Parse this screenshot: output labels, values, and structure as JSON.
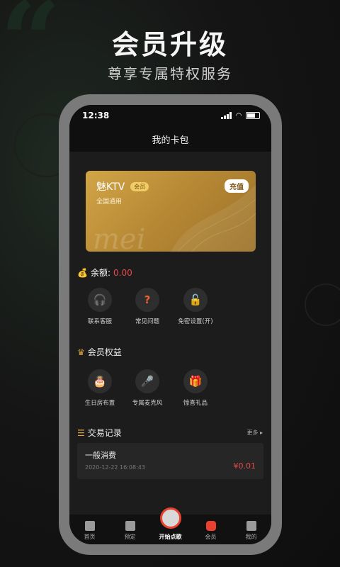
{
  "hero": {
    "title": "会员升级",
    "subtitle": "尊享专属特权服务"
  },
  "status_bar": {
    "time": "12:38"
  },
  "header": {
    "title": "我的卡包"
  },
  "card": {
    "name": "魅KTV",
    "badge": "会员",
    "scope": "全国通用",
    "recharge_label": "充值",
    "watermark": "mei",
    "color": "#c0913a"
  },
  "balance": {
    "label": "余额:",
    "value": "0.00"
  },
  "services": [
    {
      "label": "联系客服",
      "icon": "headset-icon"
    },
    {
      "label": "常见问题",
      "icon": "question-icon"
    },
    {
      "label": "免密设置(开)",
      "icon": "unlock-icon"
    }
  ],
  "benefits": {
    "title": "会员权益",
    "items": [
      {
        "label": "生日房布置",
        "icon": "cake-icon"
      },
      {
        "label": "专属麦克风",
        "icon": "microphone-icon"
      },
      {
        "label": "惊喜礼品",
        "icon": "gift-icon"
      }
    ]
  },
  "transactions": {
    "title": "交易记录",
    "more_label": "更多 ▸",
    "items": [
      {
        "title": "一般消费",
        "time": "2020-12-22 16:08:43",
        "amount": "¥0.01"
      }
    ]
  },
  "tabbar": [
    {
      "label": "首页",
      "icon": "home-icon"
    },
    {
      "label": "预定",
      "icon": "clipboard-icon"
    },
    {
      "label": "开始点歌",
      "icon": "microphone-icon"
    },
    {
      "label": "会员",
      "icon": "crown-icon"
    },
    {
      "label": "我的",
      "icon": "user-icon"
    }
  ],
  "colors": {
    "accent_red": "#e94a4a",
    "gold": "#c0913a"
  }
}
